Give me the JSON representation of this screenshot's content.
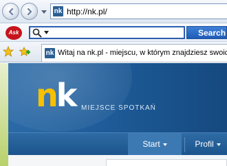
{
  "browser": {
    "address": {
      "url": "http://nk.pl/"
    },
    "search": {
      "placeholder": "",
      "button_label": "Search",
      "provider_logo": "Ask"
    },
    "tab": {
      "title": "Witaj na nk.pl - miejscu, w którym znajdziesz swoich znajomych"
    },
    "favicon_text": "nk",
    "icons": [
      "back-arrow-icon",
      "forward-arrow-icon",
      "history-dropdown-icon",
      "search-icon",
      "favorites-star-icon",
      "add-favorites-icon"
    ]
  },
  "site": {
    "logo": {
      "n": "n",
      "k": "k"
    },
    "tagline": "MIEJSCE SPOTKAŃ",
    "menu": [
      {
        "label": "Start"
      },
      {
        "label": "Profil"
      }
    ]
  },
  "colors": {
    "logo_yellow": "#f7c000",
    "header_blue": "#1e5b98",
    "search_blue": "#2a5db0",
    "ask_red": "#c7141c"
  }
}
